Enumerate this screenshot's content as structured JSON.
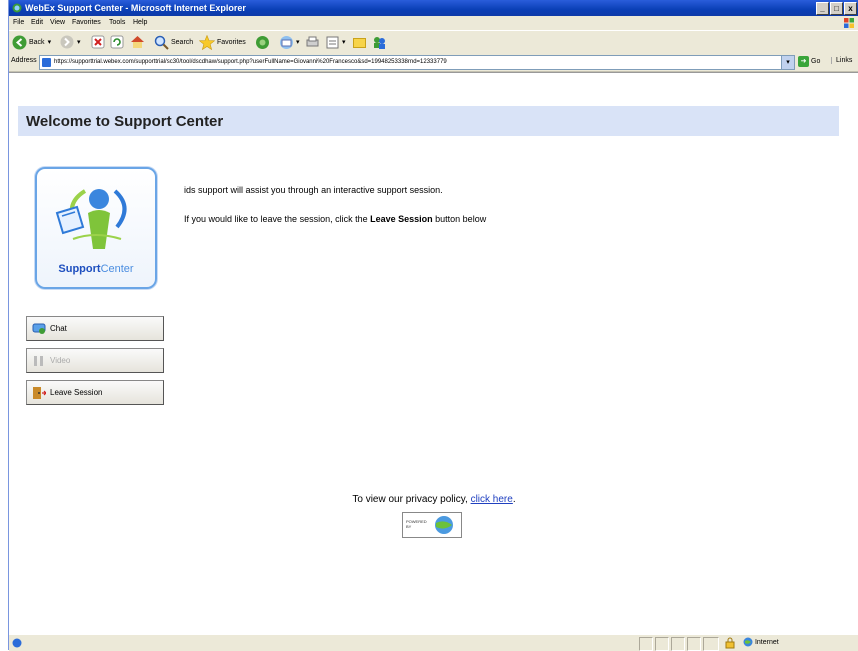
{
  "window": {
    "title": "WebEx Support Center - Microsoft Internet Explorer",
    "min": "_",
    "max": "□",
    "close": "x"
  },
  "menu": {
    "items": [
      "File",
      "Edit",
      "View",
      "Favorites",
      "Tools",
      "Help"
    ]
  },
  "toolbar": {
    "back_label": "Back",
    "search_label": "Search",
    "favorites_label": "Favorites"
  },
  "address": {
    "label": "Address",
    "url": "https://supporttrial.webex.com/supporttrial/sc30/tool/dscdhaw/support.php?userFullName=Giovanni%20Francesco&sd=19948253338rnd=12333779",
    "go_label": "Go",
    "links_label": "Links"
  },
  "page": {
    "title": "Welcome to Support Center",
    "logo_text_bold": "Support",
    "logo_text_light": "Center",
    "intro": "ids support will assist you through an interactive support session.",
    "leave_prefix": "If you would like to leave the session, click the ",
    "leave_bold": "Leave Session",
    "leave_suffix": " button below",
    "buttons": {
      "chat": "Chat",
      "video": "Video",
      "leave": "Leave Session"
    },
    "privacy_text": "To view our privacy policy, ",
    "privacy_link": "click here",
    "privacy_end": ".",
    "powered_line1": "POWERED",
    "powered_line2": "BY"
  },
  "status": {
    "zone": "Internet"
  }
}
